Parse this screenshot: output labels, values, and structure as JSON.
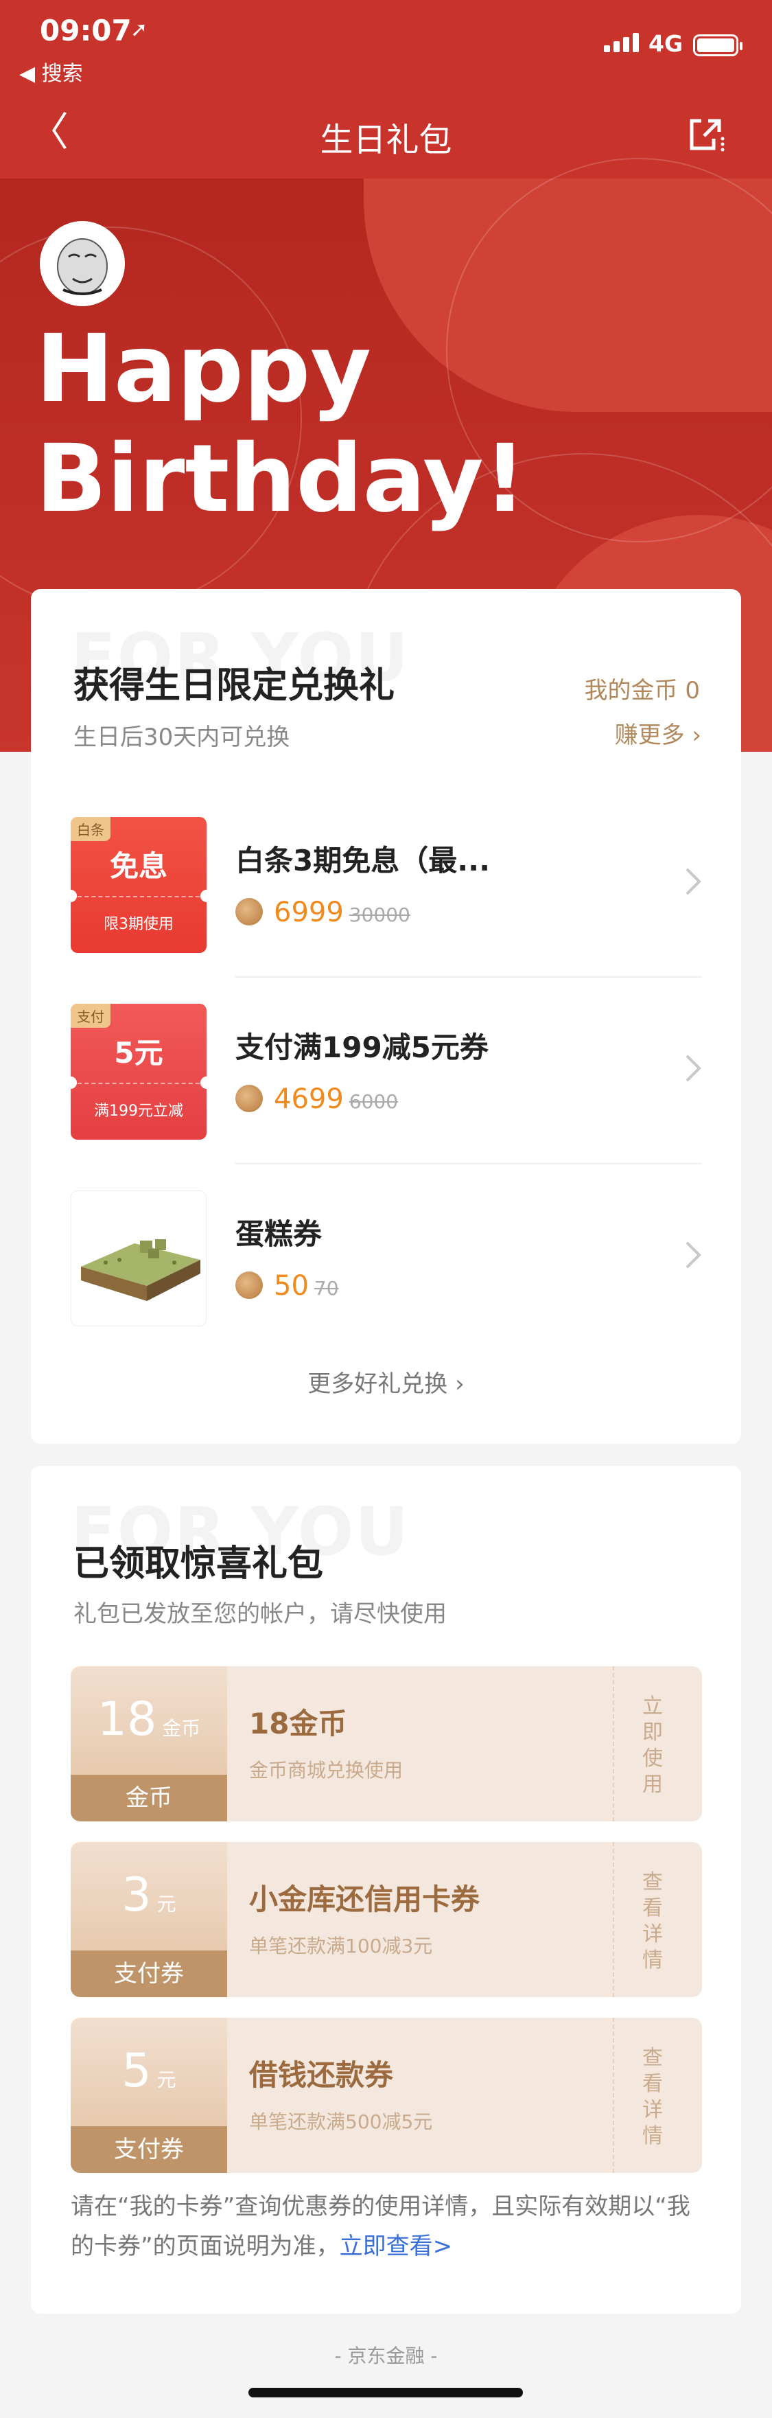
{
  "status_bar": {
    "time": "09:07",
    "location_arrow": "➚",
    "back_app": "◀ 搜索",
    "network": "4G"
  },
  "nav": {
    "back_icon": "〈",
    "title": "生日礼包"
  },
  "hero": {
    "line1": "Happy",
    "line2": "Birthday!"
  },
  "exchange": {
    "watermark": "FOR YOU",
    "title": "获得生日限定兑换礼",
    "subtitle": "生日后30天内可兑换",
    "my_coins": "我的金币 0",
    "earn_more": "赚更多 ›",
    "items": [
      {
        "tag": "白条",
        "big": "免息",
        "small": "限3期使用",
        "name": "白条3期免息（最...",
        "price": "6999",
        "old_price": "30000"
      },
      {
        "tag": "支付",
        "big": "5元",
        "small": "满199元立减",
        "name": "支付满199减5元券",
        "price": "4699",
        "old_price": "6000"
      },
      {
        "name": "蛋糕券",
        "price": "50",
        "old_price": "70"
      }
    ],
    "more": "更多好礼兑换 ›"
  },
  "received": {
    "watermark": "FOR YOU",
    "title": "已领取惊喜礼包",
    "subtitle": "礼包已发放至您的帐户，请尽快使用",
    "coupons": [
      {
        "amount": "18",
        "unit": "金币",
        "kind": "金币",
        "title": "18金币",
        "desc": "金币商城兑换使用",
        "action": "立即使用"
      },
      {
        "amount": "3",
        "unit": "元",
        "kind": "支付券",
        "title": "小金库还信用卡券",
        "desc": "单笔还款满100减3元",
        "action": "查看详情"
      },
      {
        "amount": "5",
        "unit": "元",
        "kind": "支付券",
        "title": "借钱还款券",
        "desc": "单笔还款满500减5元",
        "action": "查看详情"
      }
    ],
    "note_text": "请在“我的卡券”查询优惠券的使用详情，且实际有效期以“我的卡券”的页面说明为准，",
    "note_link": "立即查看>"
  },
  "footer": "- 京东金融 -",
  "colors": {
    "brand_red": "#c8332b",
    "coin_orange": "#f08a1c",
    "gold_text": "#b0885c",
    "link_blue": "#3b6fd8"
  }
}
